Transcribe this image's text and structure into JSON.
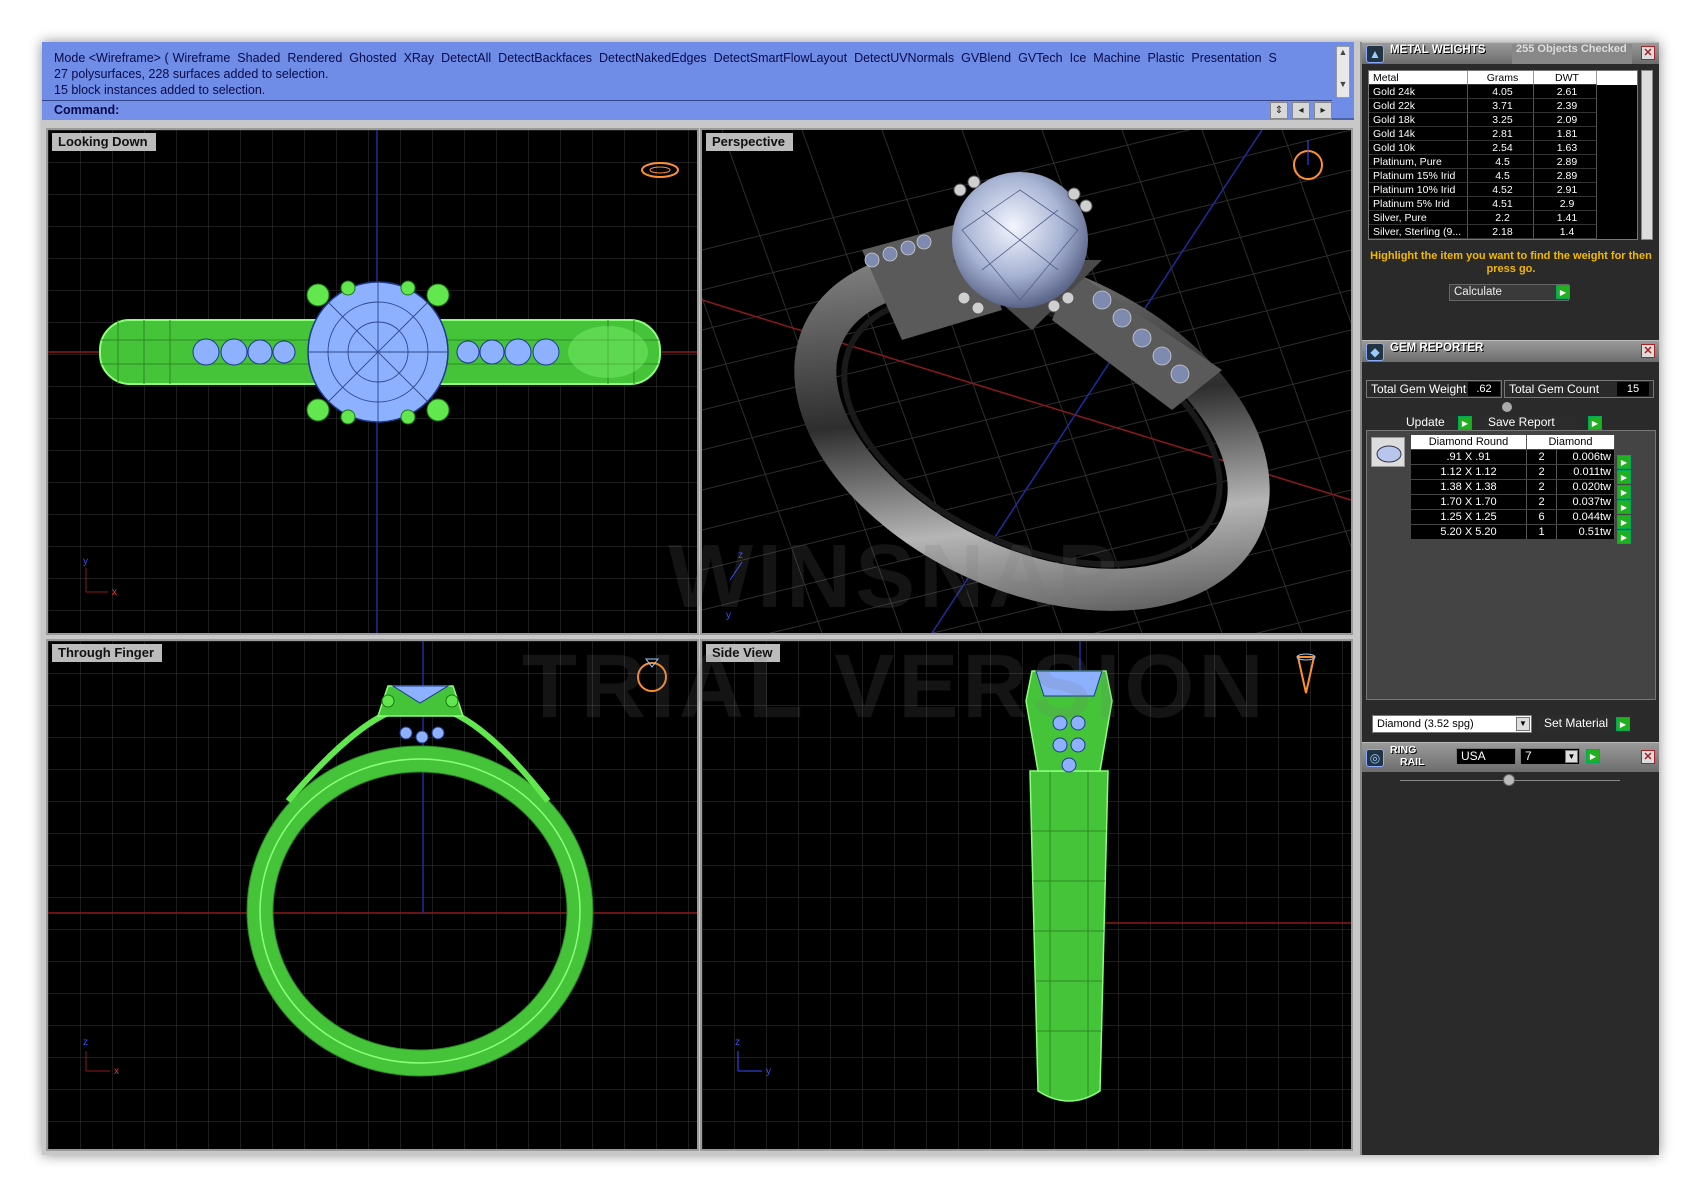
{
  "command": {
    "mode_prefix": "Mode <Wireframe> (",
    "modes": [
      "Wireframe",
      "Shaded",
      "Rendered",
      "Ghosted",
      "XRay",
      "DetectAll",
      "DetectBackfaces",
      "DetectNakedEdges",
      "DetectSmartFlowLayout",
      "DetectUVNormals",
      "GVBlend",
      "GVTech",
      "Ice",
      "Machine",
      "Plastic",
      "Presentation",
      "S"
    ],
    "history": [
      "27 polysurfaces, 228 surfaces added to selection.",
      "15 block instances added to selection."
    ],
    "prompt_label": "Command:"
  },
  "viewports": {
    "top_left": "Looking Down",
    "top_right": "Perspective",
    "bottom_left": "Through Finger",
    "bottom_right": "Side View"
  },
  "axis_labels": {
    "x": "x",
    "y": "y",
    "z": "z"
  },
  "watermark": {
    "line1": "WINSNAP",
    "line2": "TRIAL VERSION"
  },
  "metal_weights": {
    "title": "METAL WEIGHTS",
    "objects_checked": "255 Objects Checked",
    "columns": [
      "Metal",
      "Grams",
      "DWT"
    ],
    "rows": [
      [
        "Gold 24k",
        "4.05",
        "2.61"
      ],
      [
        "Gold 22k",
        "3.71",
        "2.39"
      ],
      [
        "Gold 18k",
        "3.25",
        "2.09"
      ],
      [
        "Gold 14k",
        "2.81",
        "1.81"
      ],
      [
        "Gold 10k",
        "2.54",
        "1.63"
      ],
      [
        "Platinum, Pure",
        "4.5",
        "2.89"
      ],
      [
        "Platinum 15% Irid",
        "4.5",
        "2.89"
      ],
      [
        "Platinum 10% Irid",
        "4.52",
        "2.91"
      ],
      [
        "Platinum 5% Irid",
        "4.51",
        "2.9"
      ],
      [
        "Silver, Pure",
        "2.2",
        "1.41"
      ],
      [
        "Silver, Sterling (9...",
        "2.18",
        "1.4"
      ]
    ],
    "hint": "Highlight the item you want to find the weight for then press go.",
    "calculate_label": "Calculate"
  },
  "gem_reporter": {
    "title": "GEM REPORTER",
    "total_weight_label": "Total Gem Weight",
    "total_weight_value": ".62",
    "total_count_label": "Total Gem Count",
    "total_count_value": "15",
    "update_label": "Update",
    "save_label": "Save Report",
    "columns": [
      "Diamond Round",
      "Diamond"
    ],
    "rows": [
      [
        ".91 X .91",
        "2",
        "0.006tw"
      ],
      [
        "1.12 X 1.12",
        "2",
        "0.011tw"
      ],
      [
        "1.38 X 1.38",
        "2",
        "0.020tw"
      ],
      [
        "1.70 X 1.70",
        "2",
        "0.037tw"
      ],
      [
        "1.25 X 1.25",
        "6",
        "0.044tw"
      ],
      [
        "5.20 X 5.20",
        "1",
        "0.51tw"
      ]
    ],
    "material_value": "Diamond    (3.52 spg)",
    "set_material_label": "Set Material"
  },
  "ring_rail": {
    "title_line1": "RING",
    "title_line2": "RAIL",
    "region": "USA",
    "size": "7"
  },
  "colors": {
    "wire": "#55dd44",
    "gem": "#8db0ff",
    "accent": "#f2b800",
    "command_bg": "#6f8de6"
  }
}
